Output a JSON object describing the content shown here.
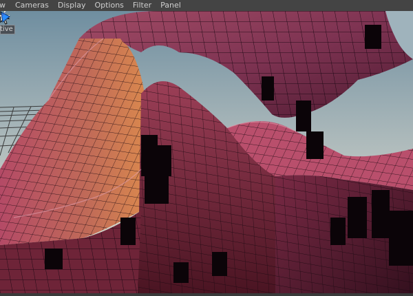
{
  "menubar": {
    "items": [
      {
        "label": "w"
      },
      {
        "label": "Cameras"
      },
      {
        "label": "Display"
      },
      {
        "label": "Options"
      },
      {
        "label": "Filter"
      },
      {
        "label": "Panel"
      }
    ]
  },
  "viewport": {
    "camera_label": "tive",
    "colors": {
      "sky_top": "#6f8ea0",
      "sky_bottom": "#e9e2cf",
      "mesh_light": "#c65a72",
      "mesh_mid": "#8a3b55",
      "mesh_dark": "#3a1020",
      "mesh_orange": "#cc7a50",
      "wire": "#1a0810"
    },
    "icons": [
      "mouse-pointer-icon",
      "crosshair-icon",
      "pivot-manipulator-icon",
      "axis-gizmo-icon"
    ]
  }
}
